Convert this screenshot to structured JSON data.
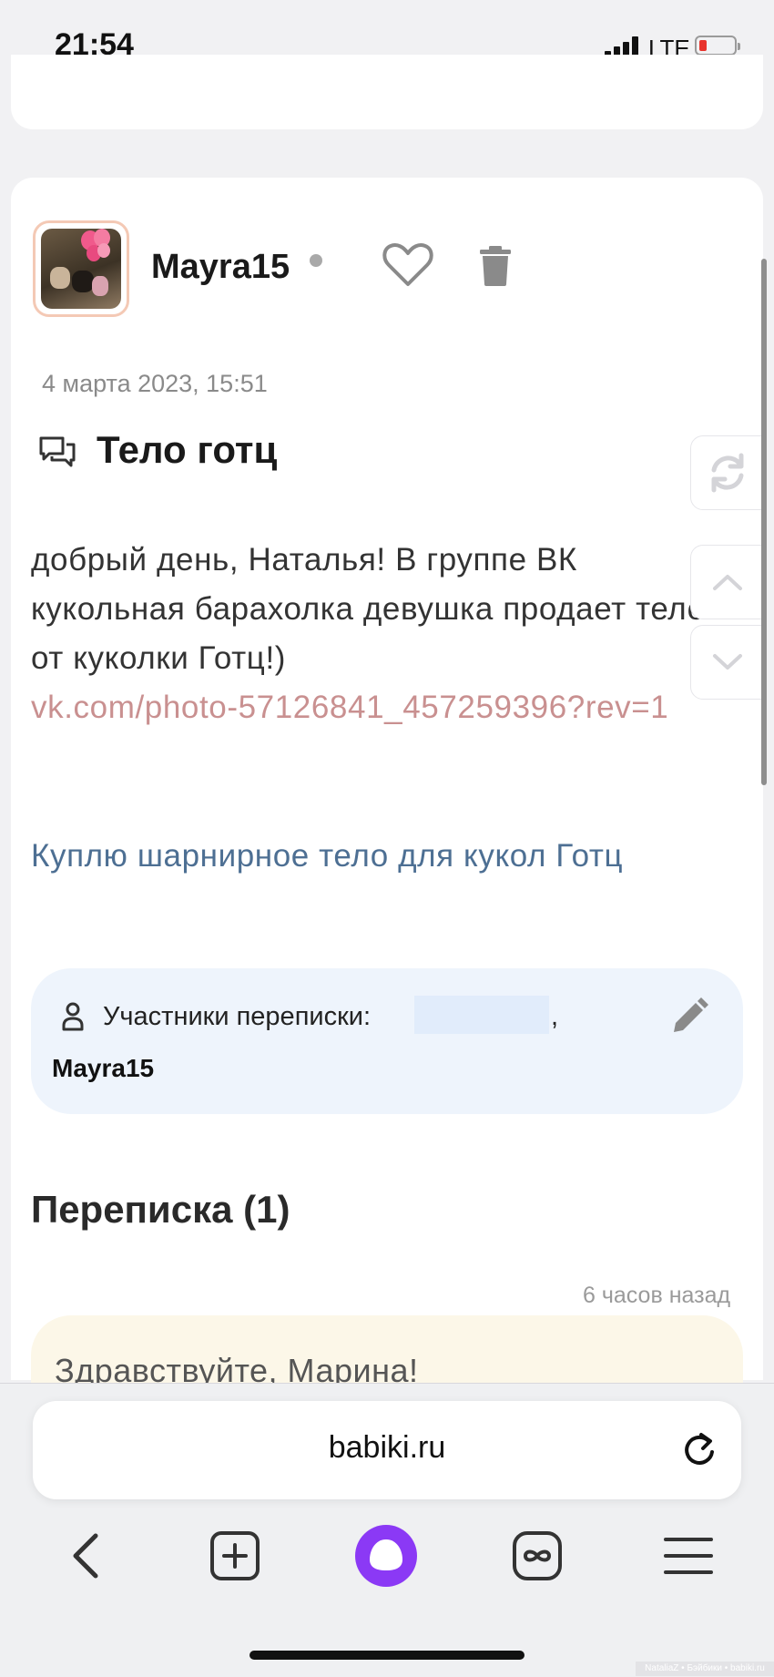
{
  "status_bar": {
    "time": "21:54",
    "network": "LTE"
  },
  "post": {
    "username": "Mayra15",
    "date": "4 марта 2023, 15:51",
    "title": "Тело готц",
    "body": "добрый день, Наталья! В группе ВК кукольная барахолка девушка продает тело от куколки Готц!)",
    "link": "vk.com/photo-57126841_457259396?rev=1",
    "related_link": "Куплю шарнирное тело для кукол Готц"
  },
  "participants": {
    "label": "Участники переписки:",
    "separator": ",",
    "names": [
      "Mayra15"
    ]
  },
  "thread": {
    "title": "Переписка (1)",
    "time_ago": "6 часов назад",
    "first_reply": "Здравствуйте, Марина!"
  },
  "browser": {
    "address": "babiki.ru"
  },
  "watermark": "NataliaZ • Бэйбики • babiki.ru",
  "colors": {
    "link": "#c99090",
    "related_link": "#4d6f93",
    "participants_bg": "#eef4fc",
    "reply_bg": "#fcf7e8",
    "alice_purple": "#8b39f5"
  },
  "icons": [
    "heart-icon",
    "trash-icon",
    "chat-icon",
    "person-icon",
    "pencil-icon",
    "refresh-icon",
    "chevron-up-icon",
    "chevron-down-icon",
    "back-icon",
    "plus-icon",
    "tabs-icon",
    "menu-icon",
    "alice-icon"
  ]
}
